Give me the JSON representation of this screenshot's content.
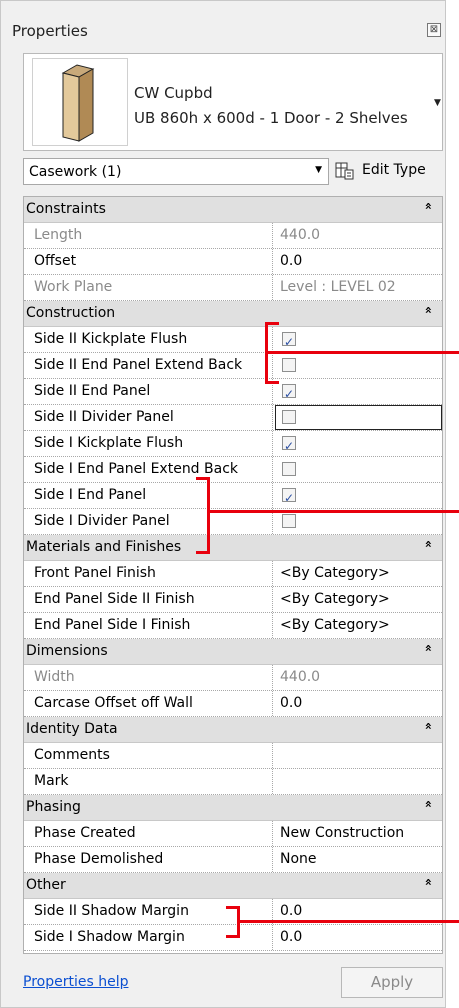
{
  "panel": {
    "title": "Properties",
    "close_glyph": "⊠"
  },
  "type_selector": {
    "name": "CW Cupbd",
    "description": "UB 860h x 600d - 1 Door - 2 Shelves",
    "dropdown_icon": "caret-down-icon"
  },
  "instance_filter": {
    "value": "Casework (1)",
    "dropdown_icon": "caret-down-icon"
  },
  "edit_type": {
    "label": "Edit Type",
    "icon": "edit-type-icon"
  },
  "groups": [
    {
      "name": "Constraints",
      "rows": [
        {
          "label": "Length",
          "value": "440.0",
          "greyed": true
        },
        {
          "label": "Offset",
          "value": "0.0",
          "greyed": false
        },
        {
          "label": "Work Plane",
          "value": "Level : LEVEL 02",
          "greyed": true
        }
      ]
    },
    {
      "name": "Construction",
      "rows": [
        {
          "label": "Side II Kickplate Flush",
          "checkbox": true,
          "checked": true
        },
        {
          "label": "Side II End Panel Extend Back",
          "checkbox": true,
          "checked": false
        },
        {
          "label": "Side II End Panel",
          "checkbox": true,
          "checked": true
        },
        {
          "label": "Side II Divider Panel",
          "checkbox": true,
          "checked": false,
          "active": true
        },
        {
          "label": "Side I Kickplate Flush",
          "checkbox": true,
          "checked": true
        },
        {
          "label": "Side I End Panel Extend Back",
          "checkbox": true,
          "checked": false
        },
        {
          "label": "Side I End Panel",
          "checkbox": true,
          "checked": true
        },
        {
          "label": "Side I Divider Panel",
          "checkbox": true,
          "checked": false
        }
      ]
    },
    {
      "name": "Materials and Finishes",
      "rows": [
        {
          "label": "Front Panel Finish",
          "value": "<By Category>"
        },
        {
          "label": "End Panel Side II Finish",
          "value": "<By Category>"
        },
        {
          "label": "End Panel Side I Finish",
          "value": "<By Category>"
        }
      ]
    },
    {
      "name": "Dimensions",
      "rows": [
        {
          "label": "Width",
          "value": "440.0",
          "greyed": true
        },
        {
          "label": "Carcase Offset off Wall",
          "value": "0.0"
        }
      ]
    },
    {
      "name": "Identity Data",
      "rows": [
        {
          "label": "Comments",
          "value": ""
        },
        {
          "label": "Mark",
          "value": ""
        }
      ]
    },
    {
      "name": "Phasing",
      "rows": [
        {
          "label": "Phase Created",
          "value": "New Construction"
        },
        {
          "label": "Phase Demolished",
          "value": "None"
        }
      ]
    },
    {
      "name": "Other",
      "rows": [
        {
          "label": "Side II Shadow Margin",
          "value": "0.0"
        },
        {
          "label": "Side I Shadow Margin",
          "value": "0.0"
        }
      ]
    }
  ],
  "collapse_glyph": "»",
  "footer": {
    "help_link": "Properties help",
    "apply_label": "Apply"
  },
  "colors": {
    "callout": "#e8000d",
    "link": "#0b4fd1",
    "group_header_bg": "#e0e0e0"
  }
}
